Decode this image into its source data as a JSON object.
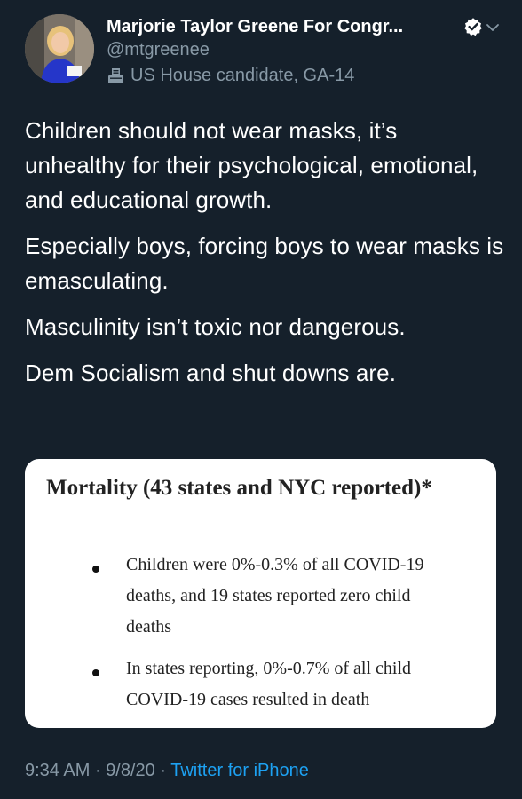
{
  "author": {
    "display_name": "Marjorie Taylor Greene For Congr...",
    "handle": "@mtgreenee",
    "label": "US House candidate, GA-14",
    "verified_icon": "verified-badge-icon",
    "caret_icon": "chevron-down-icon",
    "label_icon": "ballot-box-icon"
  },
  "tweet": {
    "paragraphs": [
      "Children should not wear masks, it’s unhealthy for their psychological, emotional, and educational growth.",
      "Especially boys, forcing boys to wear masks is emasculating.",
      "Masculinity isn’t toxic nor dangerous.",
      "Dem Socialism and shut downs are."
    ]
  },
  "card": {
    "title": "Mortality (43 states and NYC reported)*",
    "bullets": [
      "Children were 0%-0.3% of all COVID-19 deaths, and 19 states reported zero child deaths",
      "In states reporting, 0%-0.7% of all child COVID-19 cases resulted in death"
    ]
  },
  "footer": {
    "time": "9:34 AM",
    "date": "9/8/20",
    "separator": "·",
    "source": "Twitter for iPhone"
  },
  "colors": {
    "background": "#15202b",
    "text": "#ffffff",
    "muted": "#8899a6",
    "link": "#1da1f2",
    "card": "#ffffff"
  }
}
